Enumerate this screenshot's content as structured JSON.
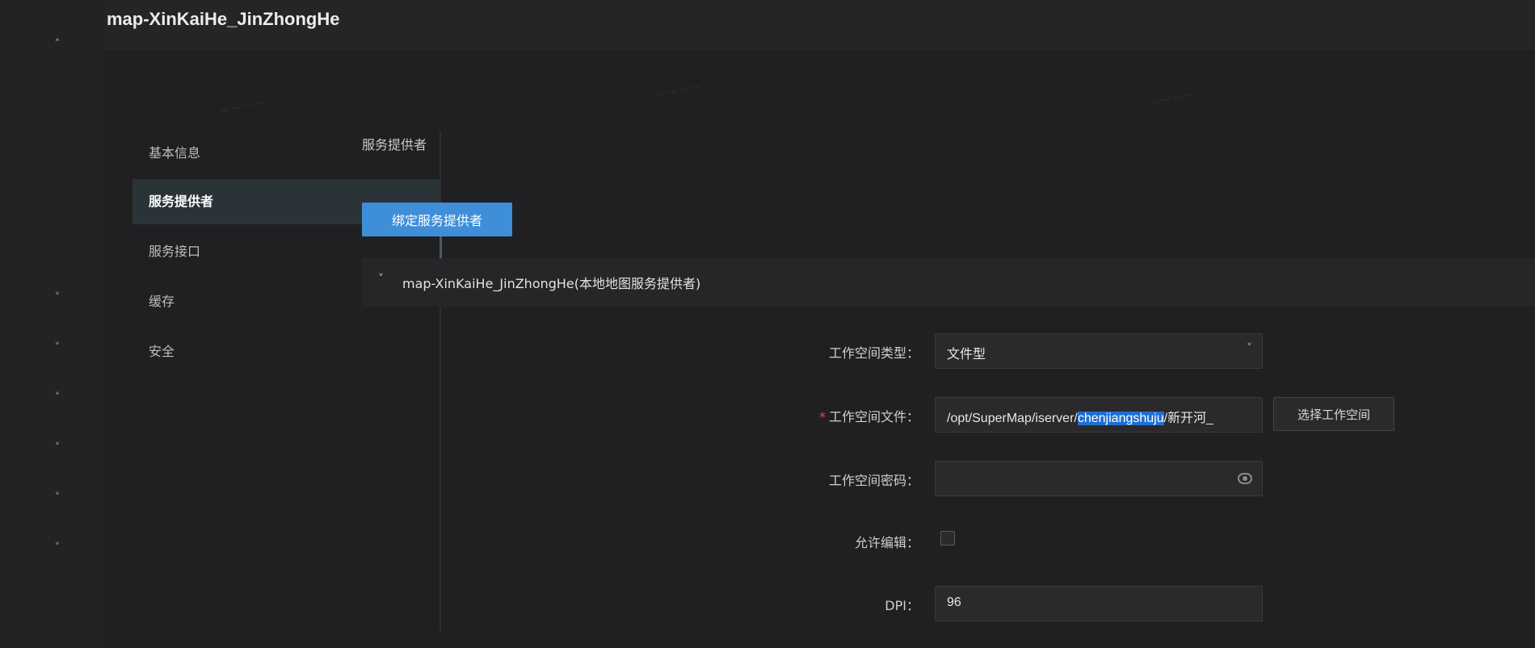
{
  "header": {
    "title": "map-XinKaiHe_JinZhongHe"
  },
  "subnav": {
    "items": [
      {
        "label": "基本信息"
      },
      {
        "label": "服务提供者"
      },
      {
        "label": "服务接口"
      },
      {
        "label": "缓存"
      },
      {
        "label": "安全"
      }
    ]
  },
  "main": {
    "section_title": "服务提供者",
    "bind_button": "绑定服务提供者",
    "provider": {
      "label": "map-XinKaiHe_JinZhongHe(本地地图服务提供者)"
    },
    "form": {
      "workspace_type_label": "工作空间类型：",
      "workspace_type_value": "文件型",
      "workspace_file_label": "工作空间文件：",
      "workspace_file_prefix": "/opt/SuperMap/iserver/",
      "workspace_file_highlight": "chenjiangshuju",
      "workspace_file_suffix": "/新开河_",
      "choose_button": "选择工作空间",
      "workspace_password_label": "工作空间密码：",
      "workspace_password_value": "",
      "allow_edit_label": "允许编辑：",
      "dpi_label": "DPI：",
      "dpi_value": "96"
    }
  },
  "colors": {
    "accent": "#3f8ed8",
    "background": "#202022",
    "required": "#e04b4b"
  }
}
